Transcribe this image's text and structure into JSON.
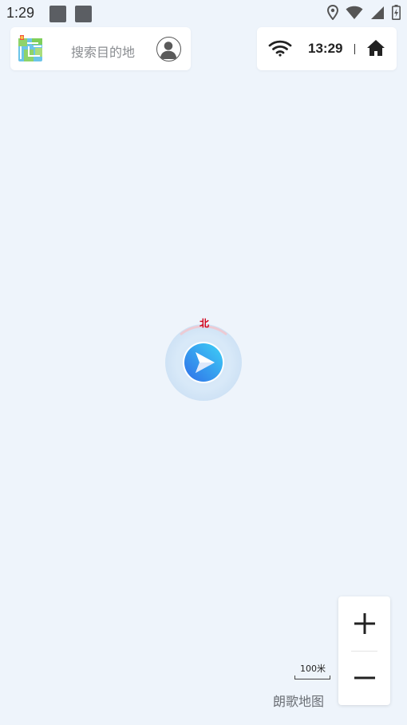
{
  "status_bar": {
    "time": "1:29",
    "icons": [
      "notification-square-icon",
      "notification-square-icon",
      "location-icon",
      "wifi-icon",
      "cell-signal-icon",
      "battery-charging-icon"
    ]
  },
  "search": {
    "placeholder": "搜索目的地",
    "logo_icon": "map-logo-icon",
    "avatar_icon": "user-avatar-icon"
  },
  "info_panel": {
    "wifi_icon": "wifi-icon",
    "time": "13:29",
    "home_icon": "home-icon"
  },
  "map": {
    "compass_label": "北",
    "marker_icon": "navigation-arrow-icon",
    "scale_label": "100米",
    "brand": "朗歌地图"
  },
  "zoom": {
    "zoom_in_icon": "plus-icon",
    "zoom_out_icon": "minus-icon"
  },
  "colors": {
    "background": "#eef4fb",
    "compass_north": "#d0021b",
    "marker_blue": "#2f80ed",
    "marker_cyan": "#3ec8f5"
  }
}
